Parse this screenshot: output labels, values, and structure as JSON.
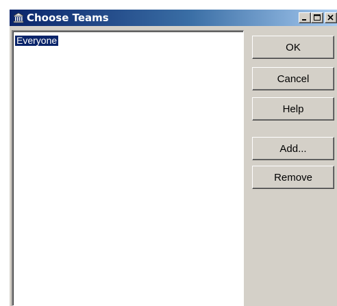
{
  "window": {
    "title": "Choose Teams",
    "app_icon": "building-icon",
    "controls": {
      "minimize_icon": "minimize-icon",
      "maximize_icon": "maximize-icon",
      "close_icon": "close-icon"
    },
    "colors": {
      "titlebar_start": "#0a246a",
      "titlebar_end": "#a6caf0",
      "face": "#d4d0c8",
      "selection": "#0a246a"
    }
  },
  "teams_list": {
    "items": [
      {
        "label": "Everyone",
        "selected": true
      }
    ]
  },
  "buttons": {
    "ok": "OK",
    "cancel": "Cancel",
    "help": "Help",
    "add": "Add...",
    "remove": "Remove"
  }
}
